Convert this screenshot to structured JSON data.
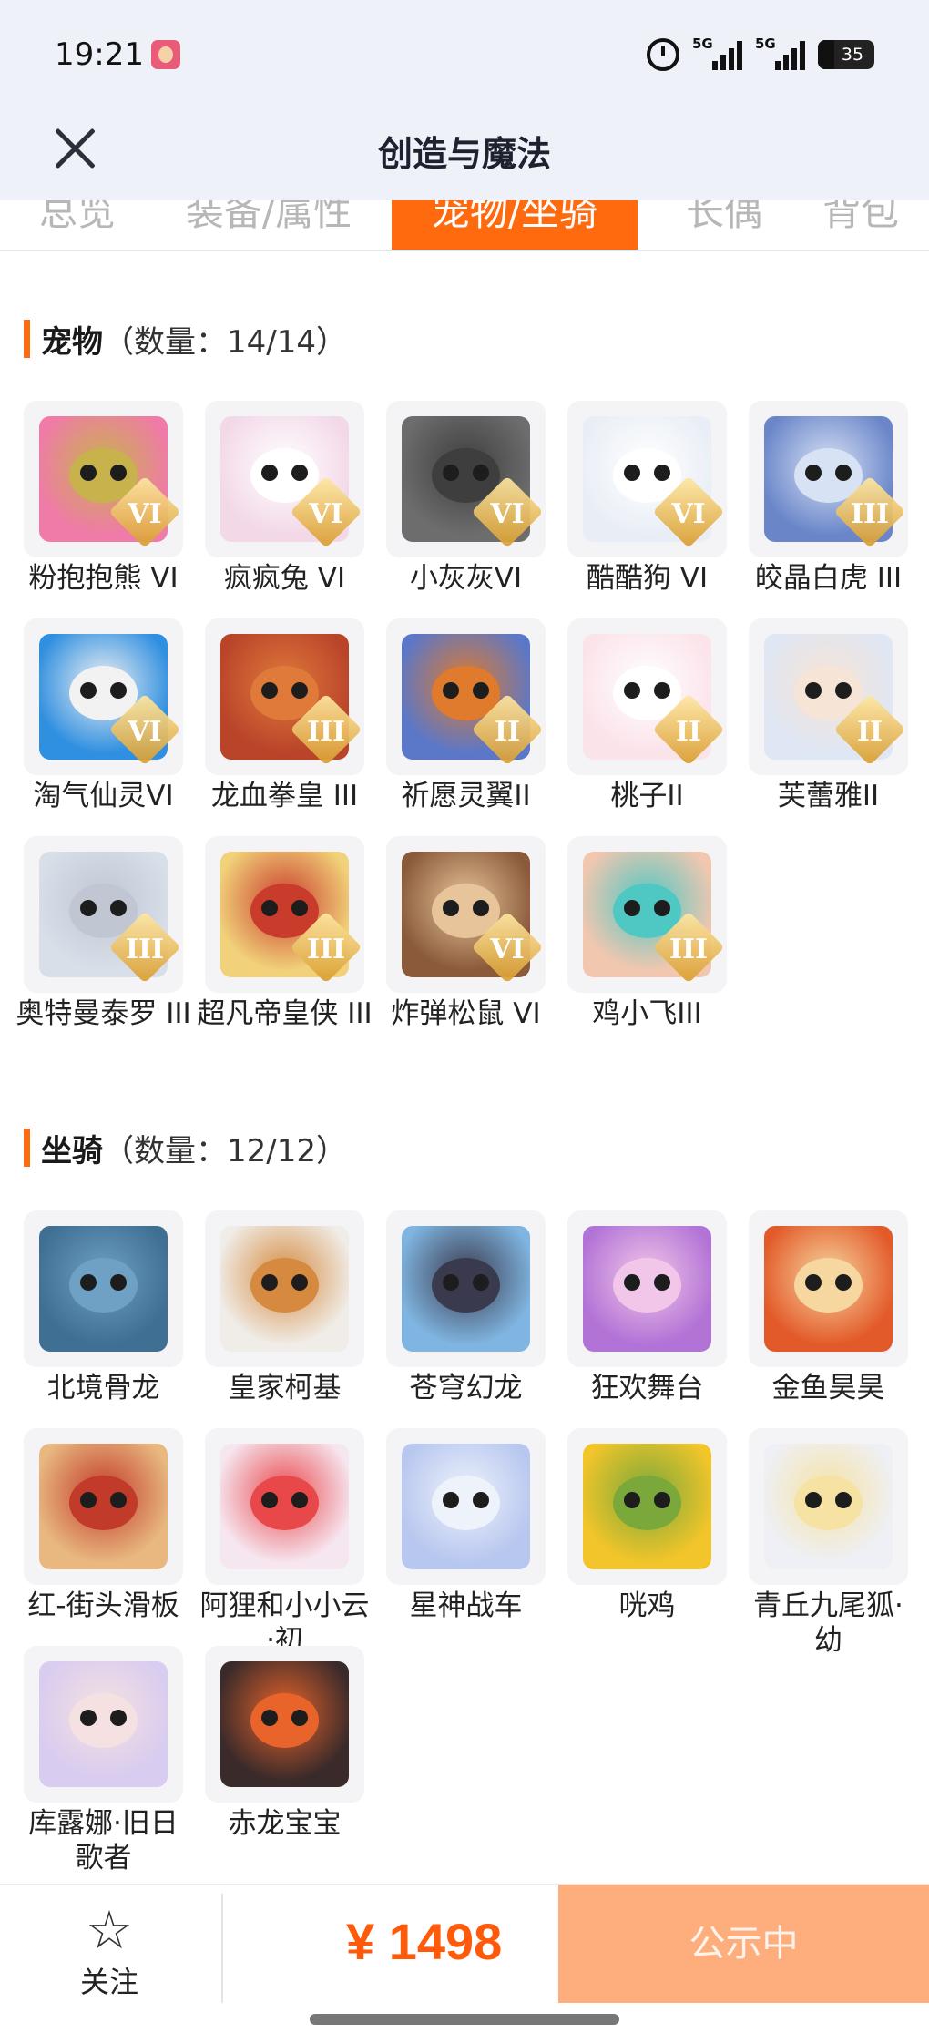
{
  "status_bar": {
    "time": "19:21",
    "network_1": "5G",
    "network_2": "5G",
    "battery": "35"
  },
  "header": {
    "title": "创造与魔法"
  },
  "tabs": [
    {
      "label": "总览",
      "active": false
    },
    {
      "label": "装备/属性",
      "active": false
    },
    {
      "label": "宠物/坐骑",
      "active": true
    },
    {
      "label": "长偶",
      "active": false
    },
    {
      "label": "背包",
      "active": false
    }
  ],
  "pets": {
    "title": "宠物",
    "count": "（数量：14/14）",
    "items": [
      {
        "name": "粉抱抱熊 VI",
        "badge": "VI",
        "color": "#f07aa8",
        "face": "#c8b24c"
      },
      {
        "name": "疯疯兔 VI",
        "badge": "VI",
        "color": "#f3d8e8",
        "face": "#ffffff"
      },
      {
        "name": "小灰灰VI",
        "badge": "VI",
        "color": "#6d6d6d",
        "face": "#3e3e3e"
      },
      {
        "name": "酷酷狗 VI",
        "badge": "VI",
        "color": "#e9eef6",
        "face": "#ffffff"
      },
      {
        "name": "皎晶白虎 III",
        "badge": "III",
        "color": "#6a86c9",
        "face": "#d8e2f5"
      },
      {
        "name": "淘气仙灵VI",
        "badge": "VI",
        "color": "#2f8fe0",
        "face": "#f2f2f2"
      },
      {
        "name": "龙血拳皇 III",
        "badge": "III",
        "color": "#b9442a",
        "face": "#e07a3b"
      },
      {
        "name": "祈愿灵翼II",
        "badge": "II",
        "color": "#5b78c8",
        "face": "#e07a2c"
      },
      {
        "name": "桃子II",
        "badge": "II",
        "color": "#fbe3ea",
        "face": "#ffffff"
      },
      {
        "name": "芙蕾雅II",
        "badge": "II",
        "color": "#dfe6f4",
        "face": "#f6e4d6"
      },
      {
        "name": "奥特曼泰罗 III",
        "badge": "III",
        "color": "#d9dfe9",
        "face": "#c0c6d2"
      },
      {
        "name": "超凡帝皇侠 III",
        "badge": "III",
        "color": "#f1d27a",
        "face": "#c93c2c"
      },
      {
        "name": "炸弹松鼠 VI",
        "badge": "VI",
        "color": "#8a5a3a",
        "face": "#e7c49a"
      },
      {
        "name": "鸡小飞III",
        "badge": "III",
        "color": "#f2c7b0",
        "face": "#4fc7c2"
      }
    ]
  },
  "mounts": {
    "title": "坐骑",
    "count": "（数量：12/12）",
    "items": [
      {
        "name": "北境骨龙",
        "color": "#3f6f93",
        "face": "#6ea1c4"
      },
      {
        "name": "皇家柯基",
        "color": "#f0ede8",
        "face": "#d58a3f"
      },
      {
        "name": "苍穹幻龙",
        "color": "#7fb5e0",
        "face": "#3a3a4e"
      },
      {
        "name": "狂欢舞台",
        "color": "#b273d6",
        "face": "#f2c6e8"
      },
      {
        "name": "金鱼昊昊",
        "color": "#e35a2a",
        "face": "#f6d7a0"
      },
      {
        "name": "红-街头滑板",
        "color": "#e8b880",
        "face": "#c23a2a"
      },
      {
        "name": "阿狸和小小云·初",
        "color": "#f6e6f0",
        "face": "#e9484b"
      },
      {
        "name": "星神战车",
        "color": "#b8c7ef",
        "face": "#eef2fb"
      },
      {
        "name": "咣鸡",
        "color": "#f2c52a",
        "face": "#7aa83a"
      },
      {
        "name": "青丘九尾狐·幼",
        "color": "#eef0f6",
        "face": "#f6e2a3"
      },
      {
        "name": "库露娜·旧日歌者",
        "color": "#d8ccf0",
        "face": "#f5e1e1"
      },
      {
        "name": "赤龙宝宝",
        "color": "#3a2a2a",
        "face": "#e8642a"
      }
    ]
  },
  "bottom_bar": {
    "follow_label": "关注",
    "price": "¥ 1498",
    "status_button": "公示中"
  }
}
